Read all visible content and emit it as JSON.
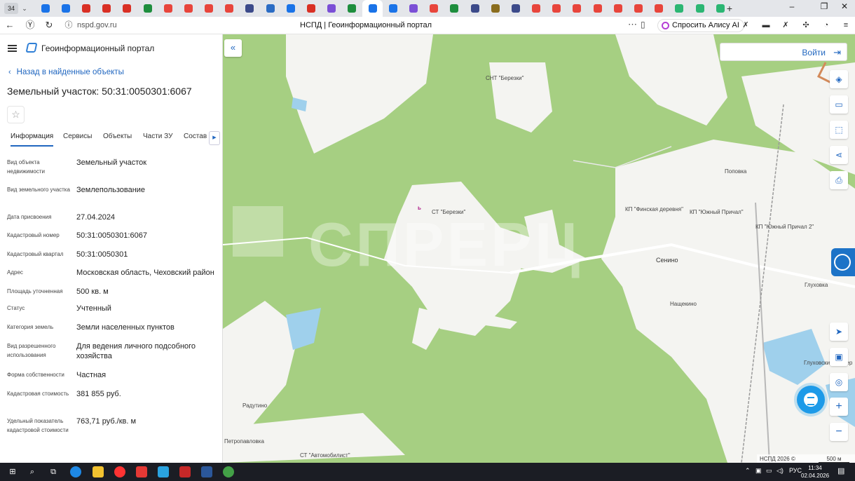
{
  "browser": {
    "tab_count": "34",
    "url": "nspd.gov.ru",
    "page_title": "НСПД | Геоинформационный портал",
    "alice_button": "Спросить Алису AI",
    "favicon_colors": [
      "#1a73e8",
      "#1a73e8",
      "#d93025",
      "#d93025",
      "#d93025",
      "#1e8e3e",
      "#e8453c",
      "#e8453c",
      "#e8453c",
      "#e8453c",
      "#3c4a8a",
      "#2b6cc4",
      "#1a73e8",
      "#d93025",
      "#7b4fd6",
      "#1e8e3e",
      "#1a73e8",
      "#1a73e8",
      "#7b4fd6",
      "#e8453c",
      "#1e8e3e",
      "#3c4a8a",
      "#8a6d1e",
      "#3c4a8a",
      "#e8453c",
      "#e8453c",
      "#e8453c",
      "#e8453c",
      "#e8453c",
      "#e8453c",
      "#e8453c",
      "#2bb673",
      "#2bb673",
      "#2bb673"
    ]
  },
  "sidebar": {
    "portal_title": "Геоинформационный портал",
    "back_link": "Назад в найденные объекты",
    "object_title": "Земельный участок: 50:31:0050301:6067",
    "star_icon": "☆",
    "tabs": [
      "Информация",
      "Сервисы",
      "Объекты",
      "Части ЗУ",
      "Состав"
    ],
    "properties": [
      {
        "label": "Вид объекта недвижимости",
        "value": "Земельный участок"
      },
      {
        "label": "Вид земельного участка",
        "value": "Землепользование"
      },
      {
        "label": "Дата присвоения",
        "value": "27.04.2024"
      },
      {
        "label": "Кадастровый номер",
        "value": "50:31:0050301:6067"
      },
      {
        "label": "Кадастровый квартал",
        "value": "50:31:0050301"
      },
      {
        "label": "Адрес",
        "value": "Московская область, Чеховский район"
      },
      {
        "label": "Площадь уточненная",
        "value": "500 кв. м"
      },
      {
        "label": "Статус",
        "value": "Учтенный"
      },
      {
        "label": "Категория земель",
        "value": "Земли населенных пунктов"
      },
      {
        "label": "Вид разрешенного использования",
        "value": "Для ведения личного подсобного хозяйства"
      },
      {
        "label": "Форма собственности",
        "value": "Частная"
      },
      {
        "label": "Кадастровая стоимость",
        "value": "381 855 руб."
      },
      {
        "label": "Удельный показатель кадастровой стоимости",
        "value": "763,71 руб./кв. м"
      }
    ]
  },
  "map": {
    "login_label": "Войти",
    "watermark": "СПРЕРЦ",
    "copyright": "НСПД 2026 ©",
    "scale": "500 м",
    "places": [
      "СНТ \"Березки\"",
      "СТ \"Березки\"",
      "КП \"Финская деревня\"",
      "КП \"Южный Причал\"",
      "КП \"Южный Причал 2\"",
      "Поповка",
      "Сенино",
      "Глуховка",
      "Нащекино",
      "Радутино",
      "Петропавловка",
      "СТ \"Автомобилист\"",
      "Глуховский карьер"
    ],
    "colors": {
      "forest": "#a6cf82",
      "open": "#f4f4f1",
      "water": "#9fd0ec",
      "accent": "#2167c0"
    }
  },
  "taskbar": {
    "lang": "РУС",
    "time": "11:34",
    "date": "02.04.2026"
  }
}
